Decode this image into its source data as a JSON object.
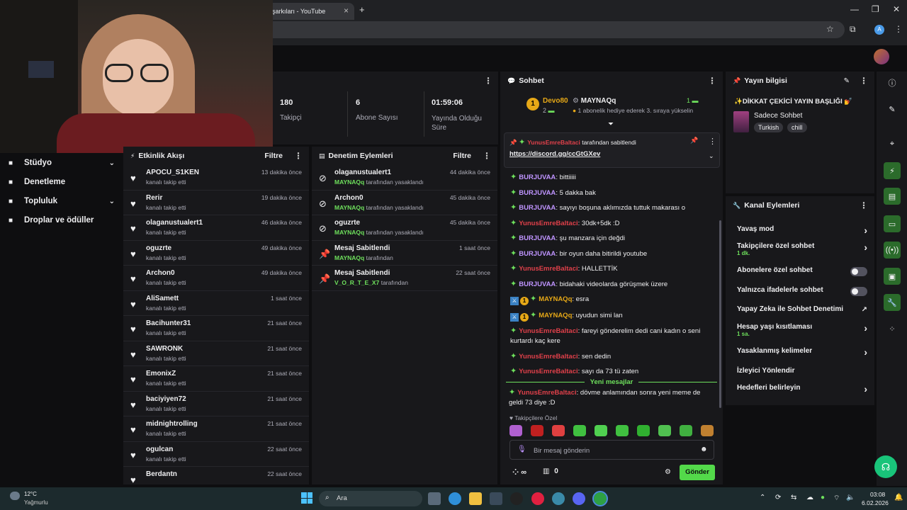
{
  "browser": {
    "tab_title": "şarkıları - YouTube",
    "tab_close": "×",
    "new_tab": "+",
    "avatar_letter": "A"
  },
  "stats": [
    {
      "value": "180",
      "label": "Takipçi"
    },
    {
      "value": "6",
      "label": "Abone Sayısı"
    },
    {
      "value": "01:59:06",
      "label": "Yayında Olduğu Süre"
    }
  ],
  "left_nav": [
    {
      "label": "Stüdyo",
      "icon": "studio-icon",
      "expandable": true
    },
    {
      "label": "Denetleme",
      "icon": "wrench-icon",
      "expandable": false
    },
    {
      "label": "Topluluk",
      "icon": "community-icon",
      "expandable": true
    },
    {
      "label": "Droplar ve ödüller",
      "icon": "drops-icon",
      "expandable": false
    }
  ],
  "activity": {
    "title": "Etkinlik Akışı",
    "filter": "Filtre",
    "items": [
      {
        "name": "APOCU_S1KEN",
        "action": "kanalı takip etti",
        "time": "13 dakika önce"
      },
      {
        "name": "Rerir",
        "action": "kanalı takip etti",
        "time": "19 dakika önce"
      },
      {
        "name": "olaganustualert1",
        "action": "kanalı takip etti",
        "time": "46 dakika önce"
      },
      {
        "name": "oguzrte",
        "action": "kanalı takip etti",
        "time": "49 dakika önce"
      },
      {
        "name": "Archon0",
        "action": "kanalı takip etti",
        "time": "49 dakika önce"
      },
      {
        "name": "AliSamett",
        "action": "kanalı takip etti",
        "time": "1 saat önce"
      },
      {
        "name": "Bacihunter31",
        "action": "kanalı takip etti",
        "time": "21 saat önce"
      },
      {
        "name": "SAWRONK",
        "action": "kanalı takip etti",
        "time": "21 saat önce"
      },
      {
        "name": "EmonixZ",
        "action": "kanalı takip etti",
        "time": "21 saat önce"
      },
      {
        "name": "baciyiyen72",
        "action": "kanalı takip etti",
        "time": "21 saat önce"
      },
      {
        "name": "midnightrolling",
        "action": "kanalı takip etti",
        "time": "21 saat önce"
      },
      {
        "name": "ogulcan",
        "action": "kanalı takip etti",
        "time": "22 saat önce"
      },
      {
        "name": "Berdantn",
        "action": "",
        "time": "22 saat önce"
      }
    ]
  },
  "moderation": {
    "title": "Denetim Eylemleri",
    "filter": "Filtre",
    "items": [
      {
        "name": "olaganustualert1",
        "actor": "MAYNAQq",
        "action": "tarafından yasaklandı",
        "time": "44 dakika önce",
        "icon": "ban"
      },
      {
        "name": "Archon0",
        "actor": "MAYNAQq",
        "action": "tarafından yasaklandı",
        "time": "45 dakika önce",
        "icon": "ban"
      },
      {
        "name": "oguzrte",
        "actor": "MAYNAQq",
        "action": "tarafından yasaklandı",
        "time": "45 dakika önce",
        "icon": "ban"
      },
      {
        "name": "Mesaj Sabitlendi",
        "actor": "MAYNAQq",
        "action": "tarafından",
        "time": "1 saat önce",
        "icon": "pin"
      },
      {
        "name": "Mesaj Sabitlendi",
        "actor": "V_O_R_T_E_X7",
        "action": "tarafından",
        "time": "22 saat önce",
        "icon": "pin"
      }
    ]
  },
  "chat": {
    "title": "Sohbet",
    "leader1": {
      "name": "Devo80",
      "count": "2",
      "rank": "1"
    },
    "leader2": {
      "name": "MAYNAQq",
      "count": "1",
      "text": "1 abonelik hediye ederek 3. sıraya yükselin"
    },
    "pinned": {
      "by": "YunusEmreBaltaci",
      "by_suffix": "tarafından sabitlendi",
      "link": "https://discord.gg/ccGtGXev"
    },
    "messages": [
      {
        "user": "BURJUVAA",
        "text": ": bittiiiii",
        "cls": "u1"
      },
      {
        "user": "BURJUVAA",
        "text": ": 5 dakka bak",
        "cls": "u1"
      },
      {
        "user": "BURJUVAA",
        "text": ": sayıyı boşuna aklımızda tuttuk makarası o",
        "cls": "u1"
      },
      {
        "user": "YunusEmreBaltaci",
        "text": ": 30dk+5dk :D",
        "cls": "u2"
      },
      {
        "user": "BURJUVAA",
        "text": ": şu manzara için değdi",
        "cls": "u1"
      },
      {
        "user": "BURJUVAA",
        "text": ": bir oyun daha bitirildi youtube",
        "cls": "u1"
      },
      {
        "user": "YunusEmreBaltaci",
        "text": ": HALLETTİK",
        "cls": "u2"
      },
      {
        "user": "BURJUVAA",
        "text": ": bidahaki videolarda görüşmek üzere",
        "cls": "u1"
      },
      {
        "user": "MAYNAQq",
        "text": ": esra",
        "cls": "u3",
        "mod": true
      },
      {
        "user": "MAYNAQq",
        "text": ": uyudun simi lan",
        "cls": "u3",
        "mod": true
      },
      {
        "user": "YunusEmreBaltaci",
        "text": ": fareyi gönderelim dedi cani kadın o seni kurtardı kaç kere",
        "cls": "u2"
      },
      {
        "user": "YunusEmreBaltaci",
        "text": ": sen dedin",
        "cls": "u2"
      },
      {
        "user": "YunusEmreBaltaci",
        "text": ": sayı da 73 tü zaten",
        "cls": "u2"
      }
    ],
    "new_messages": "Yeni mesajlar",
    "last_message": {
      "user": "YunusEmreBaltaci",
      "text": ": dövme anlamından sonra yeni meme de geldi 73 diye :D"
    },
    "followers_only_label": "Takipçilere Özel",
    "input_placeholder": "Bir mesaj gönderin",
    "points": "0",
    "send": "Gönder",
    "emote_colors": [
      "#b060d0",
      "#c02020",
      "#e04040",
      "#40c040",
      "#50d050",
      "#40c040",
      "#30b030",
      "#50c050",
      "#40b040",
      "#c08030"
    ]
  },
  "stream_info": {
    "title_label": "Yayın bilgisi",
    "stream_title": "✨DİKKAT ÇEKİCİ YAYIN BAŞLIĞI 💅",
    "category": "Sadece Sohbet",
    "tags": [
      "Turkish",
      "chill"
    ]
  },
  "channel_actions": {
    "title": "Kanal Eylemleri",
    "items": [
      {
        "label": "Yavaş mod",
        "sub": "",
        "control": "chevron"
      },
      {
        "label": "Takipçilere özel sohbet",
        "sub": "1 dk.",
        "control": "chevron"
      },
      {
        "label": "Abonelere özel sohbet",
        "sub": "",
        "control": "toggle"
      },
      {
        "label": "Yalnızca ifadelerle sohbet",
        "sub": "",
        "control": "toggle"
      },
      {
        "label": "Yapay Zeka ile Sohbet Denetimi",
        "sub": "",
        "control": "external"
      },
      {
        "label": "Hesap yaşı kısıtlaması",
        "sub": "1 sa.",
        "control": "chevron"
      },
      {
        "label": "Yasaklanmış kelimeler",
        "sub": "",
        "control": "chevron"
      },
      {
        "label": "İzleyici Yönlendir",
        "sub": "",
        "control": "none"
      },
      {
        "label": "Hedefleri belirleyin",
        "sub": "",
        "control": "chevron"
      }
    ]
  },
  "taskbar": {
    "weather_temp": "12°C",
    "weather_desc": "Yağmurlu",
    "search": "Ara",
    "time": "03:08",
    "date": "6.02.2026"
  }
}
